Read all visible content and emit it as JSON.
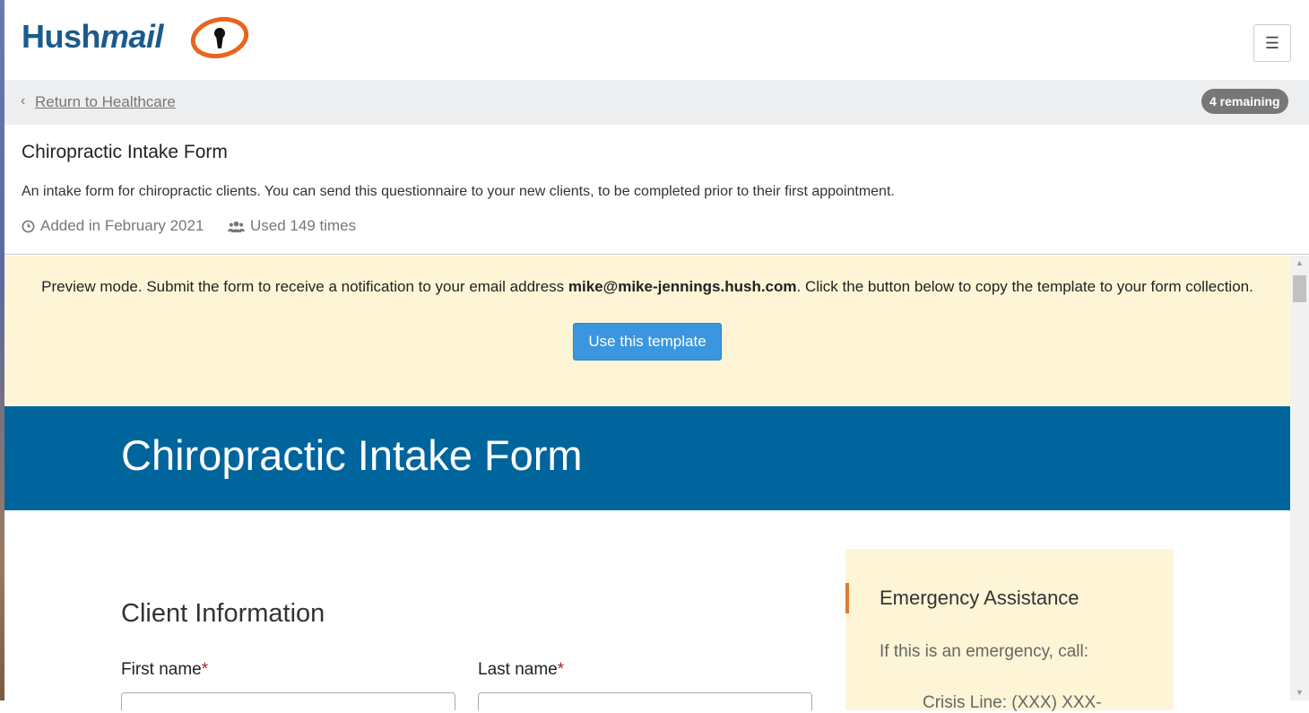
{
  "header": {
    "logo_hush": "Hush",
    "logo_mail": "mail",
    "menu_icon": "hamburger-icon"
  },
  "breadcrumb": {
    "back_label": "Return to Healthcare",
    "remaining_badge": "4 remaining"
  },
  "template_info": {
    "title": "Chiropractic Intake Form",
    "description": "An intake form for chiropractic clients. You can send this questionnaire to your new clients, to be completed prior to their first appointment.",
    "added": "Added in February 2021",
    "used": "Used 149 times"
  },
  "preview_notice": {
    "text_before": "Preview mode. Submit the form to receive a notification to your email address ",
    "email": "mike@mike-jennings.hush.com",
    "text_after": ". Click the button below to copy the template to your form collection.",
    "button_label": "Use this template"
  },
  "form": {
    "hero_title": "Chiropractic Intake Form",
    "section_title": "Client Information",
    "fields": [
      {
        "label": "First name",
        "required_mark": "*"
      },
      {
        "label": "Last name",
        "required_mark": "*"
      }
    ],
    "emergency": {
      "title": "Emergency Assistance",
      "text": "If this is an emergency, call:",
      "cut_line": "Crisis Line: (XXX) XXX-"
    }
  },
  "colors": {
    "brand_blue": "#1a5b8c",
    "logo_orange": "#e8651f",
    "hero_blue": "#00659c",
    "notice_bg": "#fdf5d6",
    "button_blue": "#3a96de",
    "required_red": "#b22222"
  }
}
